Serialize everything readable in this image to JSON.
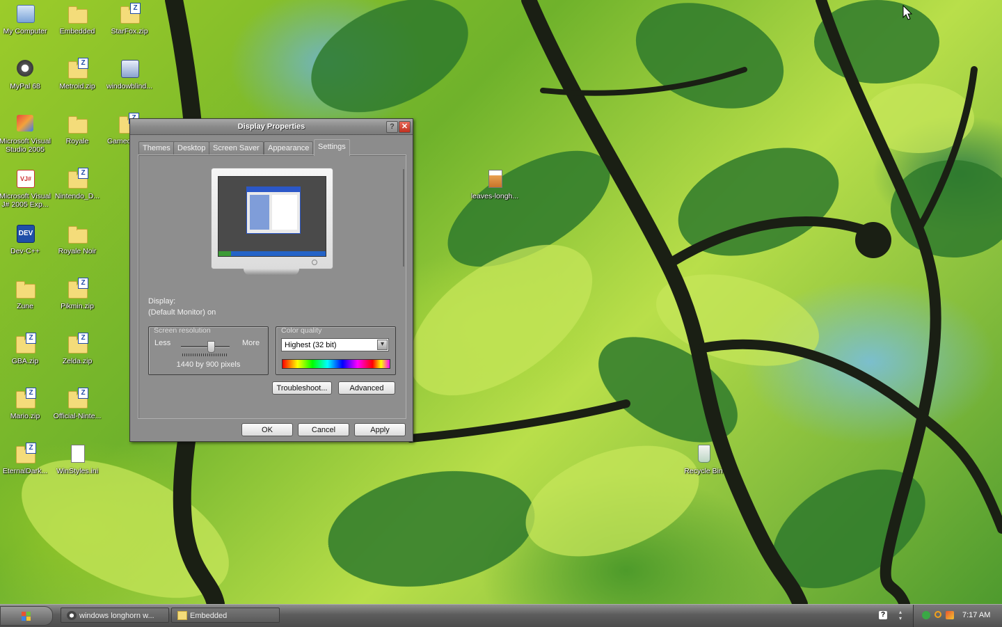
{
  "desktop": {
    "icons": [
      {
        "label": "My Computer",
        "icon": "my-computer-icon"
      },
      {
        "label": "Embedded",
        "icon": "folder-icon"
      },
      {
        "label": "StarFox.zip",
        "icon": "zip-folder-icon"
      },
      {
        "label": "MyPal 68",
        "icon": "mypal-browser-icon"
      },
      {
        "label": "Metroid.zip",
        "icon": "zip-folder-icon"
      },
      {
        "label": "windowblind...",
        "icon": "installer-icon"
      },
      {
        "label": "Microsoft Visual Studio 2005",
        "icon": "visual-studio-icon"
      },
      {
        "label": "Royale",
        "icon": "folder-icon"
      },
      {
        "label": "Gamec",
        "icon": "zip-folder-icon"
      },
      {
        "label": "Microsoft Visual J# 2005 Exp...",
        "icon": "visual-jsharp-icon"
      },
      {
        "label": "Nintendo_D...",
        "icon": "zip-folder-icon"
      },
      {
        "label": "Dev-C++",
        "icon": "devcpp-icon"
      },
      {
        "label": "Royale Noir",
        "icon": "folder-icon"
      },
      {
        "label": "Zune",
        "icon": "folder-icon"
      },
      {
        "label": "Pikmin.zip",
        "icon": "zip-folder-icon"
      },
      {
        "label": "GBA.zip",
        "icon": "zip-folder-icon"
      },
      {
        "label": "Zelda.zip",
        "icon": "zip-folder-icon"
      },
      {
        "label": "Mario.zip",
        "icon": "zip-folder-icon"
      },
      {
        "label": "Official-Ninte...",
        "icon": "zip-folder-icon"
      },
      {
        "label": "EternalDark...",
        "icon": "zip-folder-icon"
      },
      {
        "label": "WinStyles.ini",
        "icon": "ini-file-icon"
      },
      {
        "label": "leaves-longh...",
        "icon": "image-file-icon"
      },
      {
        "label": "Recycle Bin",
        "icon": "recycle-bin-icon"
      }
    ],
    "zip_badge": "Z",
    "dev_badge": "DEV",
    "vj_badge": "VJ#"
  },
  "dialog": {
    "title": "Display Properties",
    "help_glyph": "?",
    "close_glyph": "✕",
    "tabs": [
      {
        "label": "Themes",
        "active": false
      },
      {
        "label": "Desktop",
        "active": false
      },
      {
        "label": "Screen Saver",
        "active": false
      },
      {
        "label": "Appearance",
        "active": false
      },
      {
        "label": "Settings",
        "active": true
      }
    ],
    "display_label": "Display:",
    "display_value": "(Default Monitor) on",
    "resolution": {
      "group_title": "Screen resolution",
      "less": "Less",
      "more": "More",
      "value_text": "1440 by 900 pixels",
      "slider_position": 0.5
    },
    "color_quality": {
      "group_title": "Color quality",
      "selected": "Highest (32 bit)",
      "arrow_glyph": "▾"
    },
    "buttons": {
      "troubleshoot": "Troubleshoot...",
      "advanced": "Advanced",
      "ok": "OK",
      "cancel": "Cancel",
      "apply": "Apply"
    }
  },
  "taskbar": {
    "tasks": [
      {
        "label": "windows longhorn w...",
        "icon": "mypal-browser-icon"
      },
      {
        "label": "Embedded",
        "icon": "folder-icon"
      }
    ],
    "help_glyph": "?",
    "clock": "7:17 AM"
  },
  "colors": {
    "dialog_bg": "#8c8c8c",
    "close_red": "#c0301f",
    "folder_yellow": "#f4dc7a",
    "zip_blue": "#1f4aa8"
  }
}
